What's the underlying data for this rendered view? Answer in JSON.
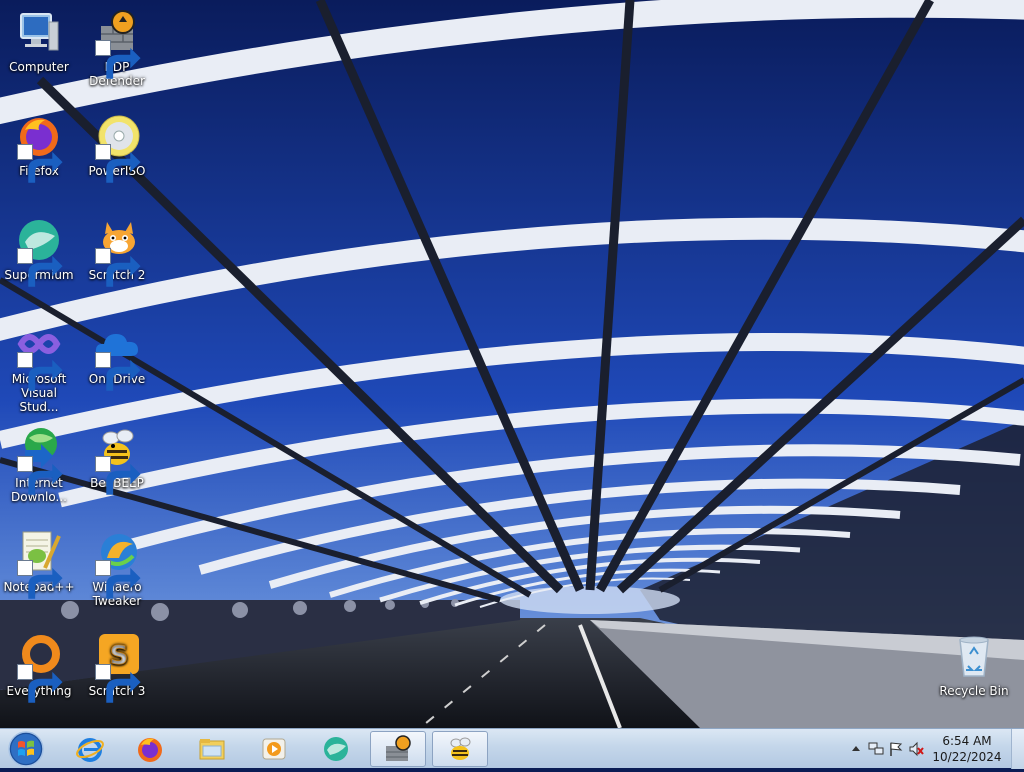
{
  "desktop": {
    "icons": [
      {
        "id": "computer",
        "label": "Computer"
      },
      {
        "id": "rdp-defender",
        "label": "RDP Defender"
      },
      {
        "id": "firefox",
        "label": "Firefox"
      },
      {
        "id": "poweriso",
        "label": "PowerISO"
      },
      {
        "id": "supermium",
        "label": "Supermium"
      },
      {
        "id": "scratch2",
        "label": "Scratch 2"
      },
      {
        "id": "visual-studio",
        "label": "Microsoft Visual Stud..."
      },
      {
        "id": "onedrive",
        "label": "OneDrive"
      },
      {
        "id": "idm",
        "label": "Internet Downlo..."
      },
      {
        "id": "beebeep",
        "label": "BeeBEEP"
      },
      {
        "id": "notepadpp",
        "label": "Notepad++"
      },
      {
        "id": "winaero",
        "label": "Winaero Tweaker"
      },
      {
        "id": "everything",
        "label": "Everything"
      },
      {
        "id": "scratch3",
        "label": "Scratch 3"
      },
      {
        "id": "recycle-bin",
        "label": "Recycle Bin"
      }
    ]
  },
  "taskbar": {
    "start_icon": "windows-start-orb-icon",
    "pinned": [
      {
        "name": "internet-explorer-icon"
      },
      {
        "name": "firefox-icon"
      },
      {
        "name": "file-explorer-icon"
      },
      {
        "name": "media-player-icon"
      },
      {
        "name": "supermium-icon"
      },
      {
        "name": "rdp-defender-icon"
      },
      {
        "name": "beebeep-icon"
      }
    ],
    "tray": {
      "icons": [
        "show-hidden-icons-chevron-icon",
        "network-icon",
        "action-center-flag-icon",
        "volume-muted-icon"
      ],
      "time": "6:54 AM",
      "date": "10/22/2024"
    }
  },
  "colors": {
    "sky": "#0e2a7a",
    "taskbar": "#c4d6ea",
    "accent_orange": "#f08a1c"
  }
}
